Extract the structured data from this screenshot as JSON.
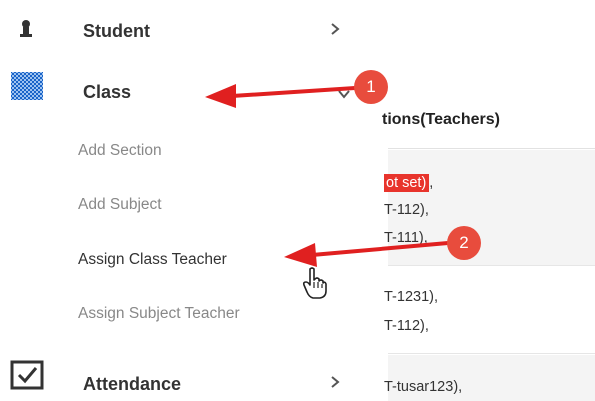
{
  "colors": {
    "accent_red": "#e84c3d",
    "menu_text": "#333333",
    "submenu_text": "#888888"
  },
  "sidebar": {
    "items": [
      {
        "label": "Student",
        "icon": "student-icon",
        "chevron": ">"
      },
      {
        "label": "Class",
        "icon": "class-grid-icon",
        "chevron": "v"
      },
      {
        "label": "Attendance",
        "icon": "checkbox-icon",
        "chevron": ">"
      }
    ],
    "submenu": [
      {
        "label": "Add Section"
      },
      {
        "label": "Add Subject"
      },
      {
        "label": "Assign Class Teacher"
      },
      {
        "label": "Assign Subject Teacher"
      }
    ]
  },
  "table": {
    "column_title": "tions(Teachers)",
    "rows": [
      {
        "lines": [
          "ot set)",
          ",",
          "T-112),",
          "T-111),"
        ]
      },
      {
        "lines": [
          "T-1231),",
          "T-112),"
        ]
      },
      {
        "lines": [
          "T-tusar123),"
        ]
      }
    ]
  },
  "callouts": [
    {
      "number": "1"
    },
    {
      "number": "2"
    }
  ]
}
